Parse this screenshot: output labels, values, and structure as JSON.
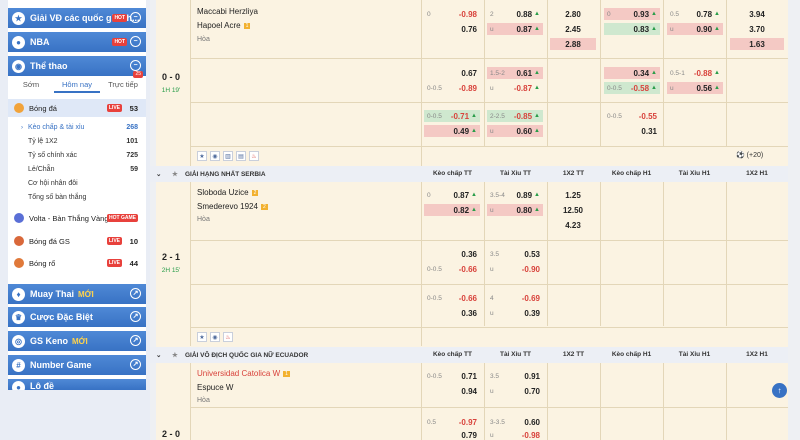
{
  "sidebar": {
    "top_league": "Giải VĐ các quốc gia ch...",
    "top_hot": "HOT",
    "nba": "NBA",
    "nba_hot": "HOT",
    "sports": "Thể thao",
    "tabs": [
      {
        "label": "Sớm"
      },
      {
        "label": "Hôm nay"
      },
      {
        "label": "Trực tiếp",
        "count": "25"
      }
    ],
    "football": {
      "label": "Bóng đá",
      "badge": "LIVE",
      "count": "53"
    },
    "sub_items": [
      {
        "label": "Kèo chấp & tài xỉu",
        "count": "268"
      },
      {
        "label": "Tỷ lệ 1X2",
        "count": "101"
      },
      {
        "label": "Tỷ số chính xác",
        "count": "725"
      },
      {
        "label": "Lẻ/Chẵn",
        "count": "59"
      },
      {
        "label": "Cơ hội nhân đôi",
        "count": ""
      },
      {
        "label": "Tổng số bàn thắng",
        "count": ""
      }
    ],
    "volta": {
      "label": "Volta - Bàn Thắng Vàng",
      "badge": "HOT GAME"
    },
    "gs_football": {
      "label": "Bóng đá GS",
      "badge": "LIVE",
      "count": "10"
    },
    "basketball": {
      "label": "Bóng rổ",
      "badge": "LIVE",
      "count": "44"
    },
    "muay": "Muay Thai",
    "muay_new": "MỚI",
    "special": "Cược Đặc Biệt",
    "keno": "GS Keno",
    "keno_new": "MỚI",
    "number": "Number Game",
    "lotto": "Lô đề"
  },
  "match1": {
    "home": "Maccabi Herzliya",
    "away": "Hapoel Acre",
    "away_card": "1",
    "draw": "Hòa",
    "score": "0 - 0",
    "time": "1H 19'",
    "r1": {
      "hc": "0",
      "hv": "-0.98",
      "ac": "",
      "av": "0.76",
      "ou_h": "2",
      "ou_hv": "0.88",
      "ou_a": "u",
      "ou_av": "0.87",
      "x1": "2.80",
      "x2": "2.45",
      "x3": "2.88",
      "h1c": "0",
      "h1v": "0.93",
      "h1a": "0.83",
      "ou1h": "0.5",
      "ou1hv": "0.78",
      "ou1a": "u",
      "ou1av": "0.90",
      "y1": "3.94",
      "y2": "3.70",
      "y3": "1.63"
    },
    "r2": {
      "hv": "0.67",
      "ac": "0-0.5",
      "av": "-0.89",
      "ou_h": "1.5-2",
      "ou_hv": "0.61",
      "ou_a": "u",
      "ou_av": "-0.87",
      "h1v": "0.34",
      "h1c": "0-0.5",
      "h1a": "-0.58",
      "ou1h": "0.5-1",
      "ou1hv": "-0.88",
      "ou1a": "u",
      "ou1av": "0.56"
    },
    "r3": {
      "hc": "0-0.5",
      "hv": "-0.71",
      "av": "0.49",
      "ou_h": "2-2.5",
      "ou_hv": "-0.85",
      "ou_a": "u",
      "ou_av": "0.60",
      "h1c": "0-0.5",
      "h1v": "-0.55",
      "h1a": "0.31"
    },
    "more": "(+20)"
  },
  "league2": {
    "name": "GIẢI HẠNG NHẤT SERBIA",
    "cols": [
      "Kèo chấp TT",
      "Tài Xỉu TT",
      "1X2 TT",
      "Kèo chấp H1",
      "Tài Xỉu H1",
      "1X2 H1"
    ]
  },
  "match2": {
    "home": "Sloboda Uzice",
    "home_card": "2",
    "away": "Smederevo 1924",
    "away_card": "2",
    "draw": "Hòa",
    "score": "2 - 1",
    "time": "2H 15'",
    "r1": {
      "hc": "0",
      "hv": "0.87",
      "av": "0.82",
      "ou_h": "3.5-4",
      "ou_hv": "0.89",
      "ou_a": "u",
      "ou_av": "0.80",
      "x1": "1.25",
      "x2": "12.50",
      "x3": "4.23"
    },
    "r2": {
      "hv": "0.36",
      "ac": "0-0.5",
      "av": "-0.66",
      "ou_h": "3.5",
      "ou_hv": "0.53",
      "ou_a": "u",
      "ou_av": "-0.90"
    },
    "r3": {
      "hc": "0-0.5",
      "hv": "-0.66",
      "av": "0.36",
      "ou_h": "4",
      "ou_hv": "-0.69",
      "ou_a": "u",
      "ou_av": "0.39"
    }
  },
  "league3": {
    "name": "GIẢI VÔ ĐỊCH QUỐC GIA NỮ ECUADOR",
    "cols": [
      "Kèo chấp TT",
      "Tài Xỉu TT",
      "1X2 TT",
      "Kèo chấp H1",
      "Tài Xỉu H1",
      "1X2 H1"
    ]
  },
  "match3": {
    "home": "Universidad Catolica W",
    "home_card": "1",
    "away": "Espuce W",
    "draw": "Hòa",
    "score": "2 - 0",
    "r1": {
      "hc": "0-0.5",
      "hv": "0.71",
      "av": "0.94",
      "ou_h": "3.5",
      "ou_hv": "0.91",
      "ou_a": "u",
      "ou_av": "0.70"
    },
    "r2": {
      "hc": "0.5",
      "hv": "-0.97",
      "ac": "",
      "av": "0.79",
      "ou_h": "3-3.5",
      "ou_hv": "0.60",
      "ou_a": "u",
      "ou_av": "-0.98"
    }
  }
}
